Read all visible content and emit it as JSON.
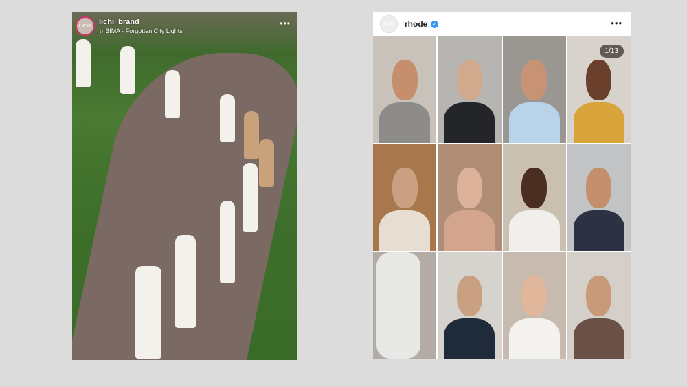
{
  "reel": {
    "username": "lichi_brand",
    "avatar_text": "LICHI",
    "music_icon": "music-note-icon",
    "music": "BIMA · Forgotten City Lights",
    "more": "•••"
  },
  "post": {
    "username": "rhode",
    "avatar_text": "rhode",
    "verified_icon": "verified-badge-icon",
    "more": "•••",
    "counter": "1/13"
  },
  "colors": {
    "verified": "#3897f0",
    "background": "#dcdcdc"
  }
}
